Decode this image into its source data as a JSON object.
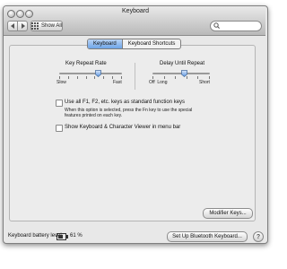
{
  "window": {
    "title": "Keyboard",
    "show_all_label": "Show All",
    "search_value": "",
    "search_placeholder": ""
  },
  "tabs": [
    {
      "label": "Keyboard",
      "selected": true
    },
    {
      "label": "Keyboard Shortcuts",
      "selected": false
    }
  ],
  "key_repeat": {
    "label": "Key Repeat Rate",
    "min_label": "Slow",
    "max_label": "Fast",
    "value_fraction": 0.62
  },
  "delay_repeat": {
    "label": "Delay Until Repeat",
    "left_labels": "Off  Long",
    "max_label": "Short",
    "value_fraction": 0.55
  },
  "options": {
    "fkeys_label": "Use all F1, F2, etc. keys as standard function keys",
    "fkeys_checked": false,
    "fkeys_help_line1": "When this option is selected, press the Fn key to use the special",
    "fkeys_help_line2": "features printed on each key.",
    "viewer_label": "Show Keyboard & Character Viewer in menu bar",
    "viewer_checked": false
  },
  "modifier_keys_label": "Modifier Keys...",
  "footer": {
    "battery_label": "Keyboard battery level:",
    "battery_value": "61 %",
    "bluetooth_label": "Set Up Bluetooth Keyboard...",
    "help_label": "?"
  }
}
